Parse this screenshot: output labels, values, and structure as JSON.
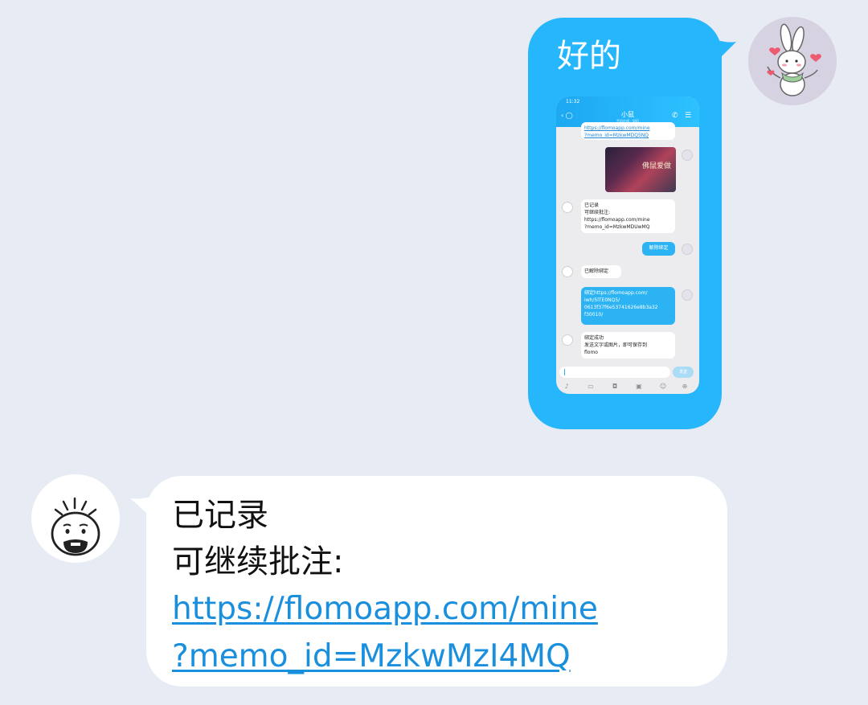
{
  "outgoing": {
    "text": "好的",
    "bubble_color": "#26b6fb",
    "avatar_icon": "bunny-avatar",
    "screenshot": {
      "status_time": "11:32",
      "contact_name": "小鼠",
      "contact_sub": "手机在线 - WiFi",
      "messages": {
        "top_link": "https://flomoapp.com/mine\n?memo_id=MzkwMDQ5NQ",
        "image_caption": "佛鼠爱做",
        "recorded": "已记录\n可继续批注:\nhttps://flomoapp.com/mine\n?memo_id=MzkwMDUwMQ",
        "cmd_unbind": "解除绑定",
        "unbound": "已解除绑定",
        "bind": "绑定https://flomoapp.com/\niwh/5lTE0NQ5/\n0613f37f6e53741626e8b3a32\nf30010/",
        "bound": "绑定成功\n发送文字或图片，即可保存到\nflomo"
      },
      "send_label": "发送"
    }
  },
  "incoming": {
    "line1": "已记录",
    "line2": "可继续批注:",
    "link_line1": "https://flomoapp.com/mine",
    "link_line2": "?memo_id=MzkwMzI4MQ",
    "avatar_icon": "sketch-face-avatar",
    "link_color": "#1a8fde"
  },
  "colors": {
    "background": "#e7ebf4",
    "accent": "#26b6fb"
  }
}
